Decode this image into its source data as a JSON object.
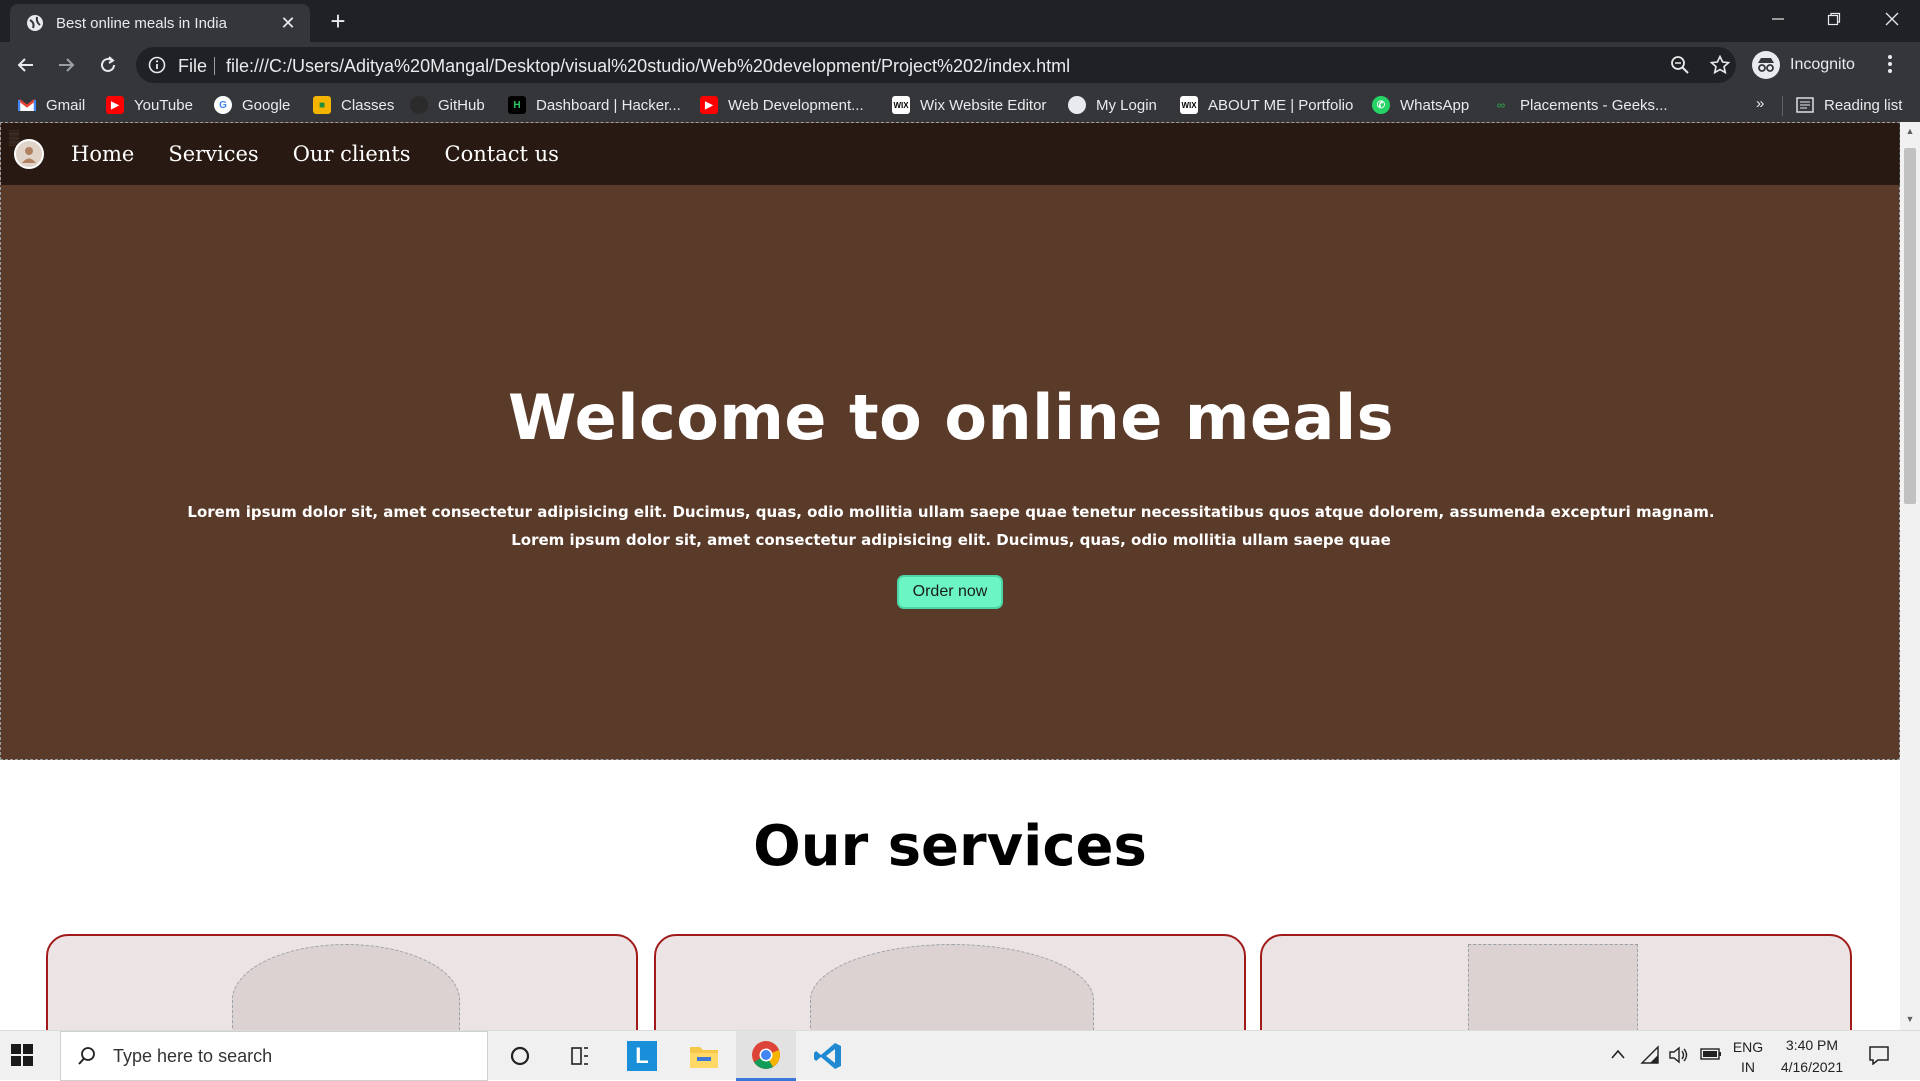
{
  "browser": {
    "tab_title": "Best online meals in India",
    "url_scheme_label": "File",
    "url": "file:///C:/Users/Aditya%20Mangal/Desktop/visual%20studio/Web%20development/Project%202/index.html",
    "profile_label": "Incognito"
  },
  "bookmarks": {
    "items": [
      {
        "label": "Gmail",
        "icon": "gmail-icon",
        "color": "#ea4335"
      },
      {
        "label": "YouTube",
        "icon": "youtube-icon",
        "color": "#ff0000"
      },
      {
        "label": "Google",
        "icon": "google-icon",
        "color": "#4285f4"
      },
      {
        "label": "Classes",
        "icon": "classroom-icon",
        "color": "#f4b400"
      },
      {
        "label": "GitHub",
        "icon": "github-icon",
        "color": "#2b2b2b"
      },
      {
        "label": "Dashboard | Hacker...",
        "icon": "hackerrank-icon",
        "color": "#000000"
      },
      {
        "label": "Web Development...",
        "icon": "youtube-icon",
        "color": "#ff0000"
      },
      {
        "label": "Wix Website Editor",
        "icon": "wix-icon",
        "color": "#ffffff"
      },
      {
        "label": "My Login",
        "icon": "globe-icon",
        "color": "#e8eaed"
      },
      {
        "label": "ABOUT ME | Portfolio",
        "icon": "wix-icon",
        "color": "#ffffff"
      },
      {
        "label": "WhatsApp",
        "icon": "whatsapp-icon",
        "color": "#25d366"
      },
      {
        "label": "Placements - Geeks...",
        "icon": "geeksforgeeks-icon",
        "color": "#2f8d46"
      }
    ],
    "overflow": "»",
    "reading_list": "Reading list"
  },
  "site": {
    "nav": [
      "Home",
      "Services",
      "Our clients",
      "Contact us"
    ],
    "hero": {
      "title": "Welcome to online meals",
      "line1": "Lorem ipsum dolor sit, amet consectetur adipisicing elit. Ducimus, quas, odio mollitia ullam saepe quae tenetur necessitatibus quos atque dolorem, assumenda excepturi magnam.",
      "line2": "Lorem ipsum dolor sit, amet consectetur adipisicing elit. Ducimus, quas, odio mollitia ullam saepe quae",
      "button": "Order now"
    },
    "services_title": "Our services",
    "accent_button_color": "#6cf5c4",
    "card_border_color": "#a11a1a"
  },
  "taskbar": {
    "search_placeholder": "Type here to search",
    "language_1": "ENG",
    "language_2": "IN",
    "time": "3:40 PM",
    "date": "4/16/2021"
  }
}
